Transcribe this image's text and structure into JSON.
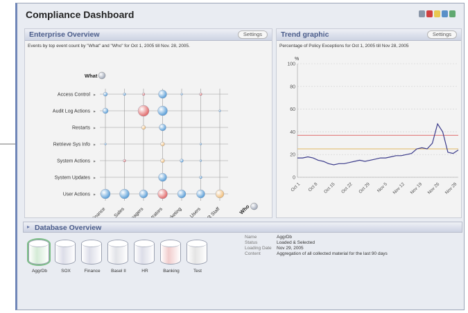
{
  "window": {
    "title": "Compliance Dashboard"
  },
  "enterprise": {
    "title": "Enterprise Overview",
    "settings_label": "Settings",
    "subtitle": "Events by top event count by \"What\" and \"Who\" for Oct 1, 2005 till Nov. 28, 2005.",
    "what_label": "What",
    "who_label": "Who",
    "rows": [
      "Access Control",
      "Audit Log Actions",
      "Restarts",
      "Retrieve Sys Info",
      "System Actions",
      "System Updates",
      "User Actions"
    ],
    "cols": [
      "Finance",
      "Sales",
      "Managers",
      "Administrators",
      "Marketing",
      "Remote Users",
      "HR Staff"
    ]
  },
  "trend": {
    "title": "Trend graphic",
    "settings_label": "Settings",
    "subtitle": "Percentage of Policy Exceptions for Oct 1, 2005 till Nov 28, 2005",
    "unit": "%"
  },
  "chart_data": {
    "type": "line",
    "x": [
      "Oct 1",
      "Oct 8",
      "Oct 15",
      "Oct 22",
      "Oct 29",
      "Nov 5",
      "Nov 12",
      "Nov 19",
      "Nov 26",
      "Nov 28"
    ],
    "y_ticks": [
      0,
      20,
      40,
      60,
      80,
      100
    ],
    "ylim": [
      0,
      100
    ],
    "series": [
      {
        "values": [
          17,
          17,
          18,
          17,
          15,
          14,
          12,
          11,
          12,
          12,
          13,
          14,
          15,
          14,
          15,
          16,
          17,
          17,
          18,
          19,
          19,
          20,
          21,
          25,
          26,
          25,
          30,
          47,
          40,
          22,
          21,
          24
        ]
      }
    ],
    "reference_lines": [
      {
        "value": 37,
        "color": "#e07070"
      },
      {
        "value": 25,
        "color": "#e0b860"
      }
    ],
    "line_color": "#3a3a8a"
  },
  "database": {
    "title": "Database Overview",
    "items": [
      {
        "label": "AggrDb",
        "color": "#d4ebd6",
        "selected": true
      },
      {
        "label": "SOX",
        "color": "#dcdde8"
      },
      {
        "label": "Finance",
        "color": "#dcdde8"
      },
      {
        "label": "Basel II",
        "color": "#e2e3e8"
      },
      {
        "label": "HR",
        "color": "#dcdde8"
      },
      {
        "label": "Banking",
        "color": "#f1cccc"
      },
      {
        "label": "Test",
        "color": "#e4e4e4"
      }
    ],
    "info": [
      {
        "key": "Name",
        "value": "AggrDb"
      },
      {
        "key": "Status",
        "value": "Loaded & Selected"
      },
      {
        "key": "Loading Date",
        "value": "Nov 29, 2005"
      },
      {
        "key": "Content",
        "value": "Aggregation of all collected material for the last 90 days"
      }
    ]
  },
  "colors": {
    "accent": "#6f86b8",
    "panel_header": "#cdd3e3"
  },
  "icons": [
    "printer-icon",
    "pdf-icon",
    "export-icon",
    "refresh-icon",
    "help-icon"
  ]
}
